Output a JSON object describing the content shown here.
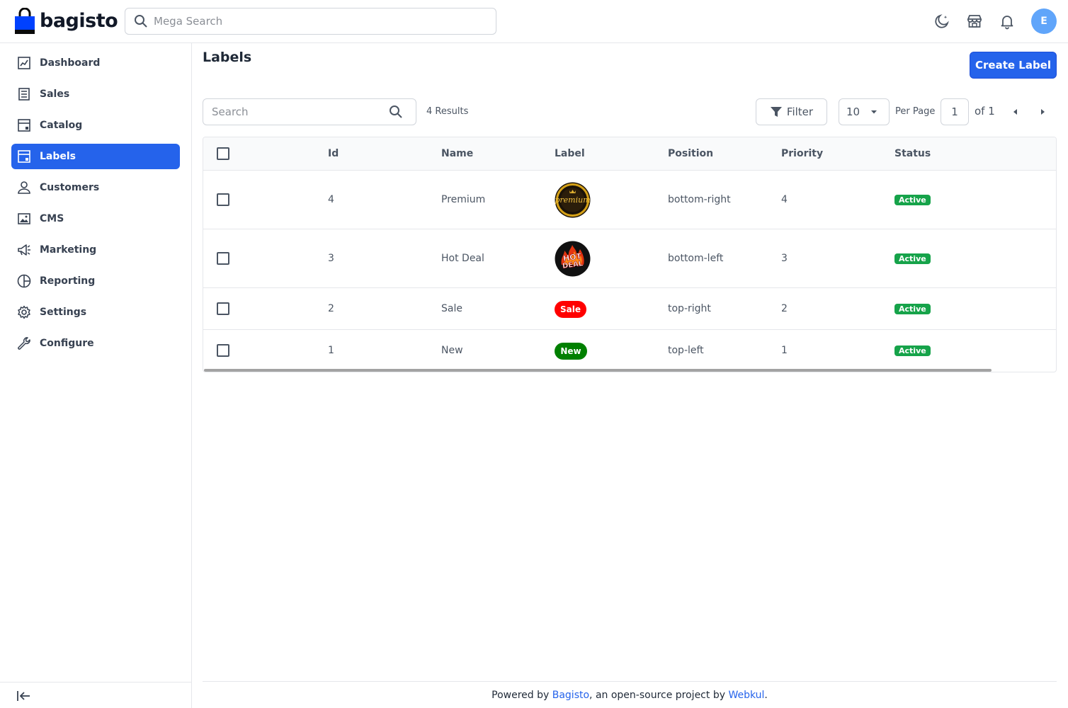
{
  "brand": {
    "name": "bagisto",
    "color": "#0041ff"
  },
  "header": {
    "search_placeholder": "Mega Search",
    "avatar_initial": "E"
  },
  "sidebar": {
    "items": [
      {
        "label": "Dashboard",
        "icon": "dashboard-icon"
      },
      {
        "label": "Sales",
        "icon": "sales-icon"
      },
      {
        "label": "Catalog",
        "icon": "catalog-icon"
      },
      {
        "label": "Labels",
        "icon": "labels-icon",
        "active": true
      },
      {
        "label": "Customers",
        "icon": "customers-icon"
      },
      {
        "label": "CMS",
        "icon": "cms-icon"
      },
      {
        "label": "Marketing",
        "icon": "marketing-icon"
      },
      {
        "label": "Reporting",
        "icon": "reporting-icon"
      },
      {
        "label": "Settings",
        "icon": "settings-icon"
      },
      {
        "label": "Configure",
        "icon": "configure-icon"
      }
    ]
  },
  "main": {
    "title": "Labels",
    "create_button": "Create Label",
    "toolbar": {
      "search_placeholder": "Search",
      "results": "4 Results",
      "filter_label": "Filter",
      "per_page_value": "10",
      "per_page_label": "Per Page",
      "current_page": "1",
      "page_of": "of 1"
    },
    "table": {
      "columns": [
        "Id",
        "Name",
        "Label",
        "Position",
        "Priority",
        "Status"
      ],
      "rows": [
        {
          "id": "4",
          "name": "Premium",
          "label_type": "image",
          "label_image": "premium-badge",
          "label_text": "premium",
          "position": "bottom-right",
          "priority": "4",
          "status": "Active"
        },
        {
          "id": "3",
          "name": "Hot Deal",
          "label_type": "image",
          "label_image": "hot-deal-badge",
          "label_text": "HOT DEAL",
          "position": "bottom-left",
          "priority": "3",
          "status": "Active"
        },
        {
          "id": "2",
          "name": "Sale",
          "label_type": "pill",
          "label_text": "Sale",
          "label_color": "#ff0000",
          "position": "top-right",
          "priority": "2",
          "status": "Active"
        },
        {
          "id": "1",
          "name": "New",
          "label_type": "pill",
          "label_text": "New",
          "label_color": "#008000",
          "position": "top-left",
          "priority": "1",
          "status": "Active"
        }
      ]
    }
  },
  "footer": {
    "prefix": "Powered by ",
    "link1": "Bagisto",
    "middle": ", an open-source project by ",
    "link2": "Webkul",
    "suffix": "."
  },
  "colors": {
    "accent": "#2563eb",
    "status_active": "#16a34a"
  }
}
